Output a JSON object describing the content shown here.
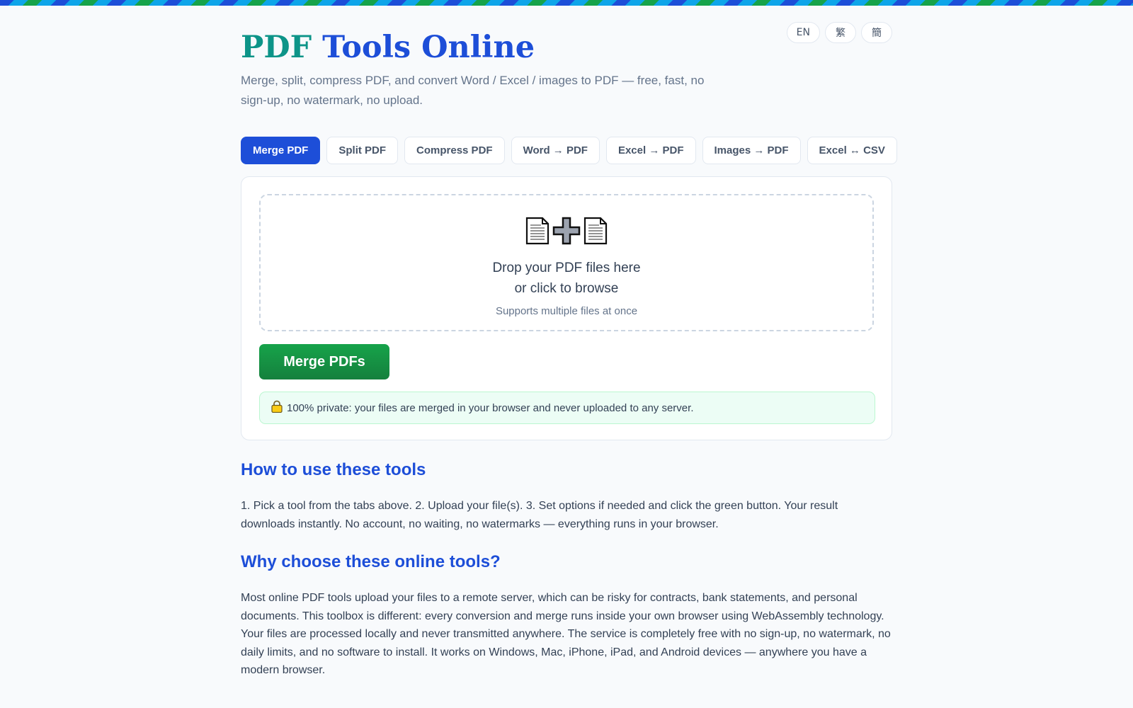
{
  "header": {
    "title_part1": "PDF",
    "title_part2": "Tools Online",
    "subtitle": "Merge, split, compress PDF, and convert Word / Excel / images to PDF — free, fast, no sign-up, no watermark, no upload."
  },
  "languages": [
    "EN",
    "繁",
    "簡"
  ],
  "tabs": [
    {
      "label": "Merge PDF",
      "active": true
    },
    {
      "label": "Split PDF",
      "active": false
    },
    {
      "label": "Compress PDF",
      "active": false
    },
    {
      "label": "Word → PDF",
      "active": false
    },
    {
      "label": "Excel → PDF",
      "active": false
    },
    {
      "label": "Images → PDF",
      "active": false
    },
    {
      "label": "Excel ↔ CSV",
      "active": false
    }
  ],
  "dropzone": {
    "icons": [
      "document-icon",
      "plus-icon",
      "document-icon"
    ],
    "line1": "Drop your PDF files here",
    "line2": "or click to browse",
    "hint": "Supports multiple files at once"
  },
  "action": {
    "label": "Merge PDFs"
  },
  "privacy": {
    "icon": "lock-icon",
    "text": "100% private: your files are merged in your browser and never uploaded to any server."
  },
  "howto": {
    "heading": "How to use these tools",
    "text": "1. Pick a tool from the tabs above. 2. Upload your file(s). 3. Set options if needed and click the green button. Your result downloads instantly. No account, no waiting, no watermarks — everything runs in your browser."
  },
  "why": {
    "heading": "Why choose these online tools?",
    "text": "Most online PDF tools upload your files to a remote server, which can be risky for contracts, bank statements, and personal documents. This toolbox is different: every conversion and merge runs inside your own browser using WebAssembly technology. Your files are processed locally and never transmitted anywhere. The service is completely free with no sign-up, no watermark, no daily limits, and no software to install. It works on Windows, Mac, iPhone, iPad, and Android devices — anywhere you have a modern browser."
  },
  "colors": {
    "primary": "#1d4ed8",
    "accent_teal": "#0d9488",
    "success": "#16a34a"
  }
}
